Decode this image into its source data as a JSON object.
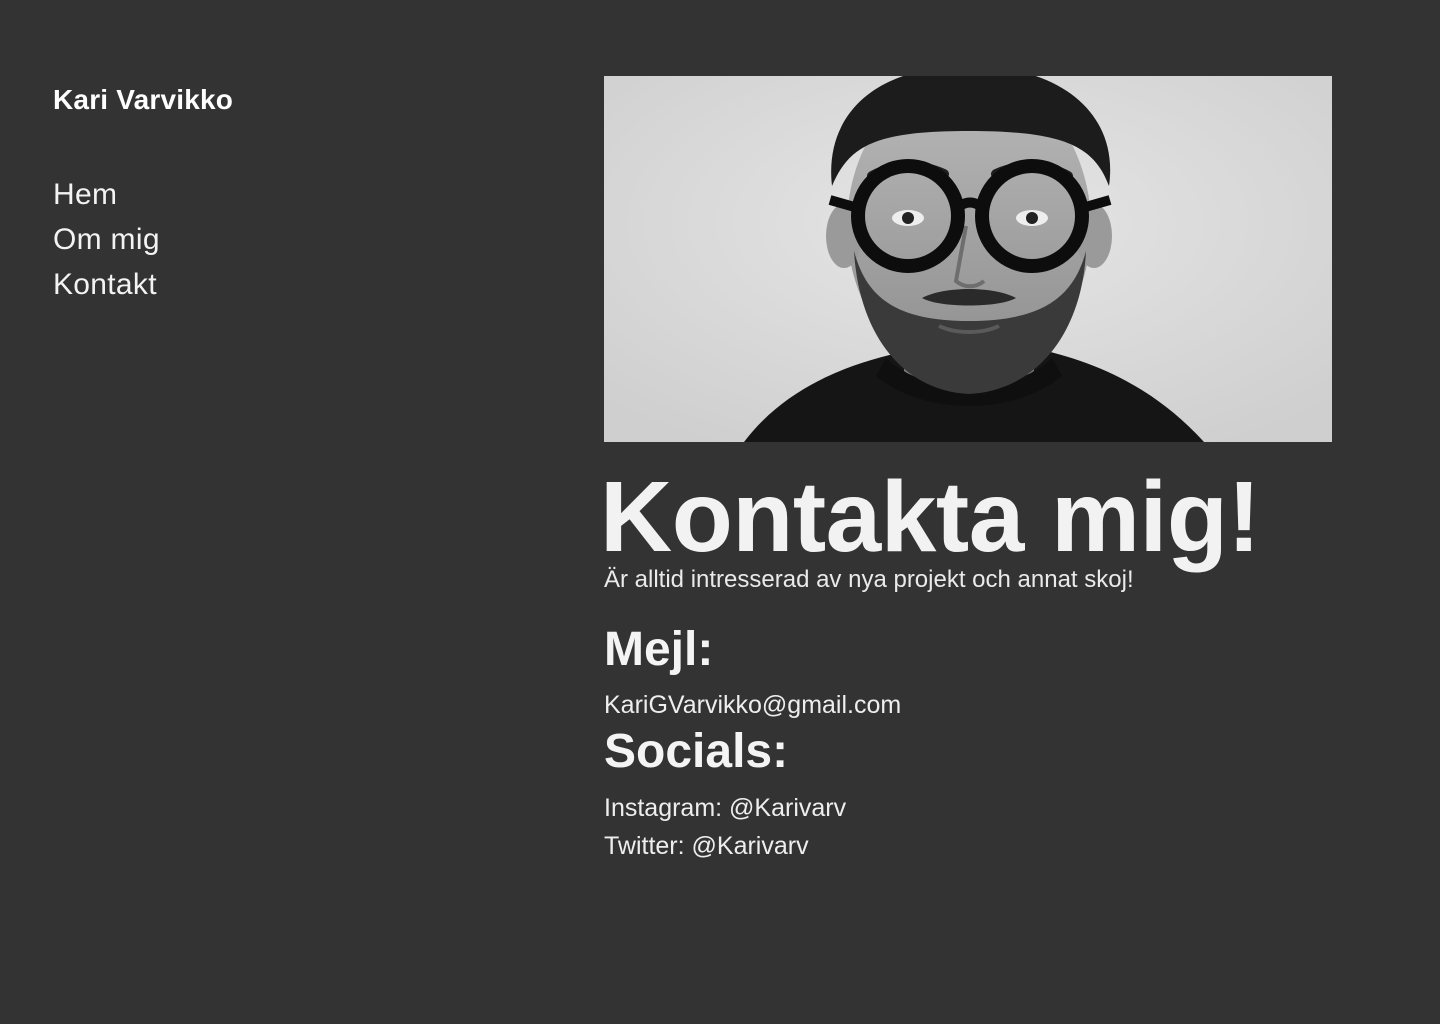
{
  "brand": {
    "name": "Kari Varvikko"
  },
  "nav": {
    "items": [
      {
        "label": "Hem"
      },
      {
        "label": "Om mig"
      },
      {
        "label": "Kontakt"
      }
    ]
  },
  "hero": {
    "image_icon": "portrait-photo",
    "heading": "Kontakta mig!",
    "subtitle": "Är alltid intresserad av nya projekt och annat skoj!"
  },
  "mail": {
    "title": "Mejl:",
    "address": "KariGVarvikko@gmail.com"
  },
  "socials": {
    "title": "Socials:",
    "items": [
      {
        "text": "Instagram: @Karivarv"
      },
      {
        "text": "Twitter: @Karivarv"
      }
    ]
  },
  "colors": {
    "background": "#333333",
    "text": "#f3f3f3"
  }
}
